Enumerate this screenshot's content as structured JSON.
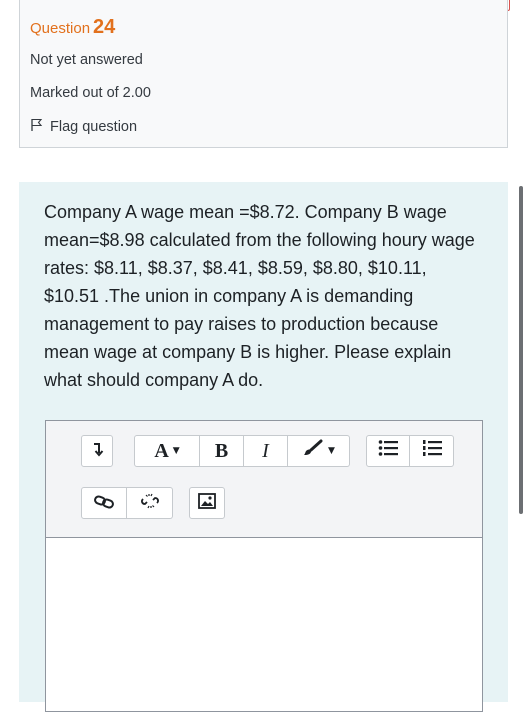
{
  "question": {
    "label": "Question",
    "number": "24",
    "state": "Not yet answered",
    "marks": "Marked out of 2.00",
    "flag_label": "Flag question"
  },
  "question_text": "Company A wage mean =$8.72. Company B wage mean=$8.98 calculated from the following houry wage rates: $8.11, $8.37, $8.41, $8.59, $8.80, $10.11, $10.51 .The union in company A is demanding management to pay raises to production because mean wage at company B is higher. Please explain what should company A do.",
  "editor": {
    "toolbar": {
      "font_label": "A",
      "bold_label": "B",
      "italic_label": "I"
    },
    "answer_value": ""
  },
  "colors": {
    "accent": "#e2711d",
    "content_bg": "#e7f3f5",
    "alert_border": "#d9534f"
  }
}
